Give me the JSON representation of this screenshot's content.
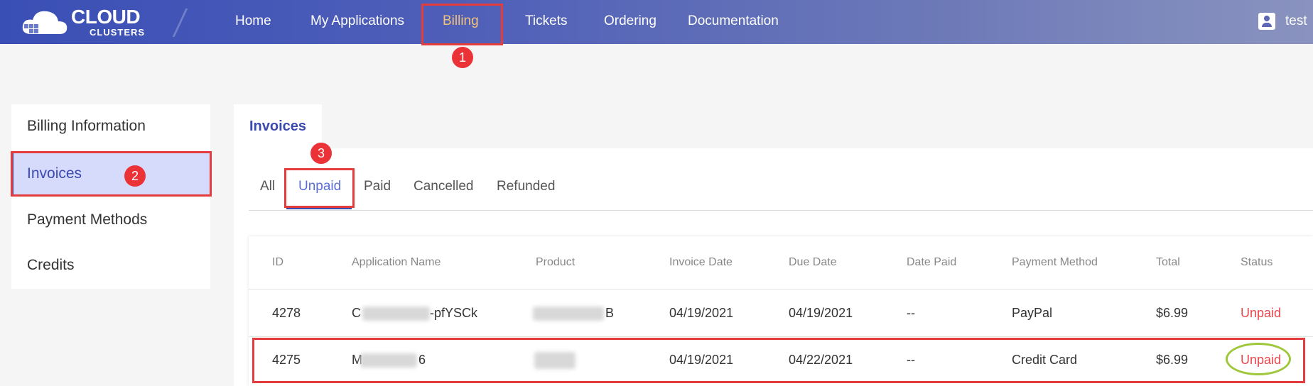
{
  "header": {
    "logo_main": "CLOUD",
    "logo_sub": "CLUSTERS",
    "nav": [
      {
        "label": "Home"
      },
      {
        "label": "My Applications"
      },
      {
        "label": "Billing"
      },
      {
        "label": "Tickets"
      },
      {
        "label": "Ordering"
      },
      {
        "label": "Documentation"
      }
    ],
    "user": "test"
  },
  "sidebar": {
    "items": [
      {
        "label": "Billing Information"
      },
      {
        "label": "Invoices"
      },
      {
        "label": "Payment Methods"
      },
      {
        "label": "Credits"
      }
    ]
  },
  "main": {
    "section_title": "Invoices",
    "filters": [
      {
        "label": "All"
      },
      {
        "label": "Unpaid"
      },
      {
        "label": "Paid"
      },
      {
        "label": "Cancelled"
      },
      {
        "label": "Refunded"
      }
    ],
    "table": {
      "headers": [
        "ID",
        "Application Name",
        "Product",
        "Invoice Date",
        "Due Date",
        "Date Paid",
        "Payment Method",
        "Total",
        "Status"
      ],
      "rows": [
        {
          "id": "4278",
          "app_prefix": "C",
          "app_suffix": "-pfYSCk",
          "product_suffix": "B",
          "invoice_date": "04/19/2021",
          "due_date": "04/19/2021",
          "date_paid": "--",
          "payment_method": "PayPal",
          "total": "$6.99",
          "status": "Unpaid"
        },
        {
          "id": "4275",
          "app_prefix": "M",
          "app_suffix": "6",
          "product_suffix": "",
          "invoice_date": "04/19/2021",
          "due_date": "04/22/2021",
          "date_paid": "--",
          "payment_method": "Credit Card",
          "total": "$6.99",
          "status": "Unpaid"
        }
      ]
    }
  },
  "annotations": {
    "step1": "1",
    "step2": "2",
    "step3": "3"
  },
  "colors": {
    "accent": "#3b4ab0",
    "nav_active": "#f0c27a",
    "status_unpaid": "#e8474c",
    "highlight": "#e23c3c",
    "ellipse": "#9fc73a"
  }
}
